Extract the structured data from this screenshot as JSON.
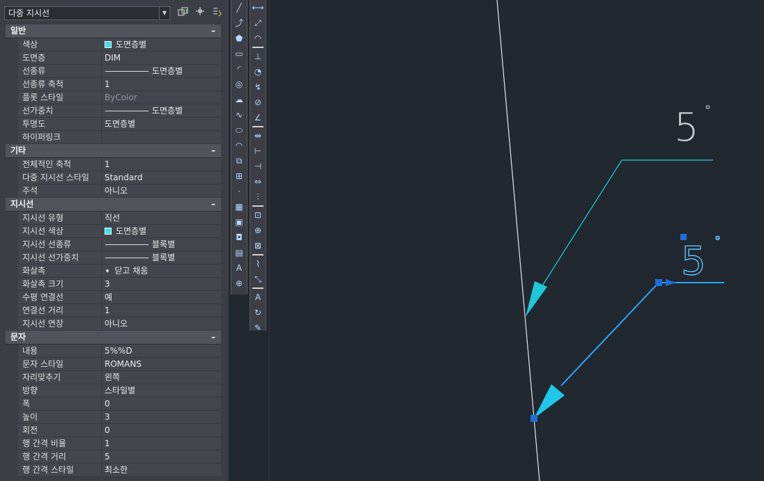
{
  "selector": {
    "value": "다중 지시선"
  },
  "sections": [
    {
      "title": "일반",
      "collapse": "–",
      "rows": [
        {
          "label": "색상",
          "value": "도면층별",
          "kind": "color"
        },
        {
          "label": "도면층",
          "value": "DIM"
        },
        {
          "label": "선종류",
          "value": "도면층별",
          "kind": "line"
        },
        {
          "label": "선종류 축척",
          "value": "1"
        },
        {
          "label": "플롯 스타일",
          "value": "ByColor",
          "kind": "dim"
        },
        {
          "label": "선가중치",
          "value": "도면층별",
          "kind": "line"
        },
        {
          "label": "투명도",
          "value": "도면층별"
        },
        {
          "label": "하이퍼링크",
          "value": ""
        }
      ]
    },
    {
      "title": "기타",
      "collapse": "–",
      "rows": [
        {
          "label": "전체적인 축척",
          "value": "1"
        },
        {
          "label": "다중 지시선 스타일",
          "value": "Standard"
        },
        {
          "label": "주석",
          "value": "아니오"
        }
      ]
    },
    {
      "title": "지시선",
      "collapse": "–",
      "rows": [
        {
          "label": "지시선 유형",
          "value": "직선"
        },
        {
          "label": "지시선 색상",
          "value": "도면층별",
          "kind": "color"
        },
        {
          "label": "지시선 선종류",
          "value": "블록별",
          "kind": "line"
        },
        {
          "label": "지시선 선가중치",
          "value": "블록별",
          "kind": "line"
        },
        {
          "label": "화살촉",
          "value": "닫고 채움",
          "kind": "arrow"
        },
        {
          "label": "화살촉 크기",
          "value": "3"
        },
        {
          "label": "수평 연결선",
          "value": "예"
        },
        {
          "label": "연결선 거리",
          "value": "1"
        },
        {
          "label": "지시선 연장",
          "value": "아니오"
        }
      ]
    },
    {
      "title": "문자",
      "collapse": "–",
      "rows": [
        {
          "label": "내용",
          "value": "5%%D"
        },
        {
          "label": "문자 스타일",
          "value": "ROMANS"
        },
        {
          "label": "자리맞추기",
          "value": "왼쪽"
        },
        {
          "label": "방향",
          "value": "스타일별"
        },
        {
          "label": "폭",
          "value": "0"
        },
        {
          "label": "높이",
          "value": "3"
        },
        {
          "label": "회전",
          "value": "0"
        },
        {
          "label": "행 간격 비율",
          "value": "1"
        },
        {
          "label": "행 간격 거리",
          "value": "5"
        },
        {
          "label": "행 간격 스타일",
          "value": "최소한"
        }
      ]
    }
  ],
  "toolbar_left": [
    "construction-line-icon",
    "polyline-icon",
    "polygon-icon",
    "rectangle-icon",
    "arc-icon",
    "circle-icon",
    "revision-cloud-icon",
    "spline-icon",
    "ellipse-icon",
    "ellipse-arc-icon",
    "insert-block-icon",
    "make-block-icon",
    "point-icon",
    "hatch-icon",
    "gradient-icon",
    "region-icon",
    "table-icon",
    "multiline-text-icon",
    "add-selected-icon"
  ],
  "toolbar_right": [
    "linear-dim-icon",
    "aligned-dim-icon",
    "arc-length-dim-icon",
    "ordinate-dim-icon",
    "radius-dim-icon",
    "jogged-dim-icon",
    "diameter-dim-icon",
    "angular-dim-icon",
    "quick-dim-icon",
    "baseline-dim-icon",
    "continue-dim-icon",
    "dim-space-icon",
    "dim-break-icon",
    "tolerance-icon",
    "center-mark-icon",
    "inspection-icon",
    "jogged-linear-icon",
    "dim-edit-icon",
    "dim-text-edit-icon",
    "dim-update-icon",
    "dim-style-icon"
  ],
  "canvas": {
    "text_upper": "5",
    "text_lower": "5",
    "degree": "°",
    "colors": {
      "background": "#212830",
      "leader": "#1ec8d8",
      "selected": "#2aa8ff",
      "grip": "#1e6fd8",
      "text": "#c8cbce",
      "line": "#e6e6e6"
    }
  }
}
